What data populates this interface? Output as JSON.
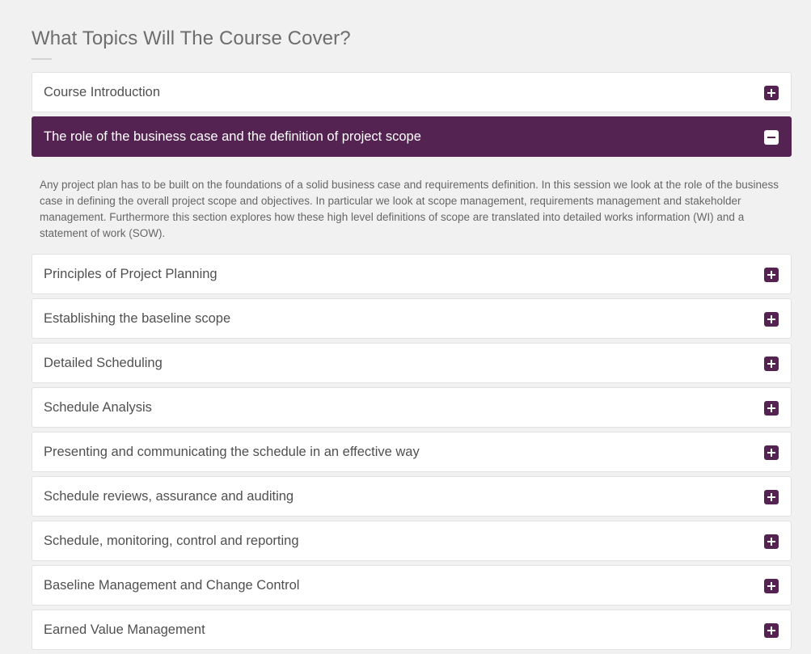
{
  "section": {
    "title": "What Topics Will The Course Cover?"
  },
  "accordion": {
    "items": [
      {
        "label": "Course Introduction",
        "icon": "plus-icon"
      },
      {
        "label": "The role of the business case and the definition of project scope",
        "icon": "minus-icon",
        "expanded": true,
        "body": "Any project plan has to be built on the foundations of a solid business case and requirements definition. In this session we look at the role of the business case in defining the overall project scope and objectives. In particular we look at scope management, requirements management and stakeholder management. Furthermore this section explores how these high level definitions of scope are translated into detailed works information (WI) and a statement of work (SOW)."
      },
      {
        "label": "Principles of Project Planning",
        "icon": "plus-icon"
      },
      {
        "label": "Establishing the baseline scope",
        "icon": "plus-icon"
      },
      {
        "label": "Detailed Scheduling",
        "icon": "plus-icon"
      },
      {
        "label": "Schedule Analysis",
        "icon": "plus-icon"
      },
      {
        "label": "Presenting and communicating the schedule in an effective way",
        "icon": "plus-icon"
      },
      {
        "label": "Schedule reviews, assurance and auditing",
        "icon": "plus-icon"
      },
      {
        "label": "Schedule, monitoring, control and reporting",
        "icon": "plus-icon"
      },
      {
        "label": "Baseline Management and Change Control",
        "icon": "plus-icon"
      },
      {
        "label": "Earned Value Management",
        "icon": "plus-icon"
      }
    ]
  },
  "colors": {
    "accent": "#542352",
    "page_background": "#f1f1f1",
    "panel_background": "#ffffff",
    "text": "#505050"
  }
}
